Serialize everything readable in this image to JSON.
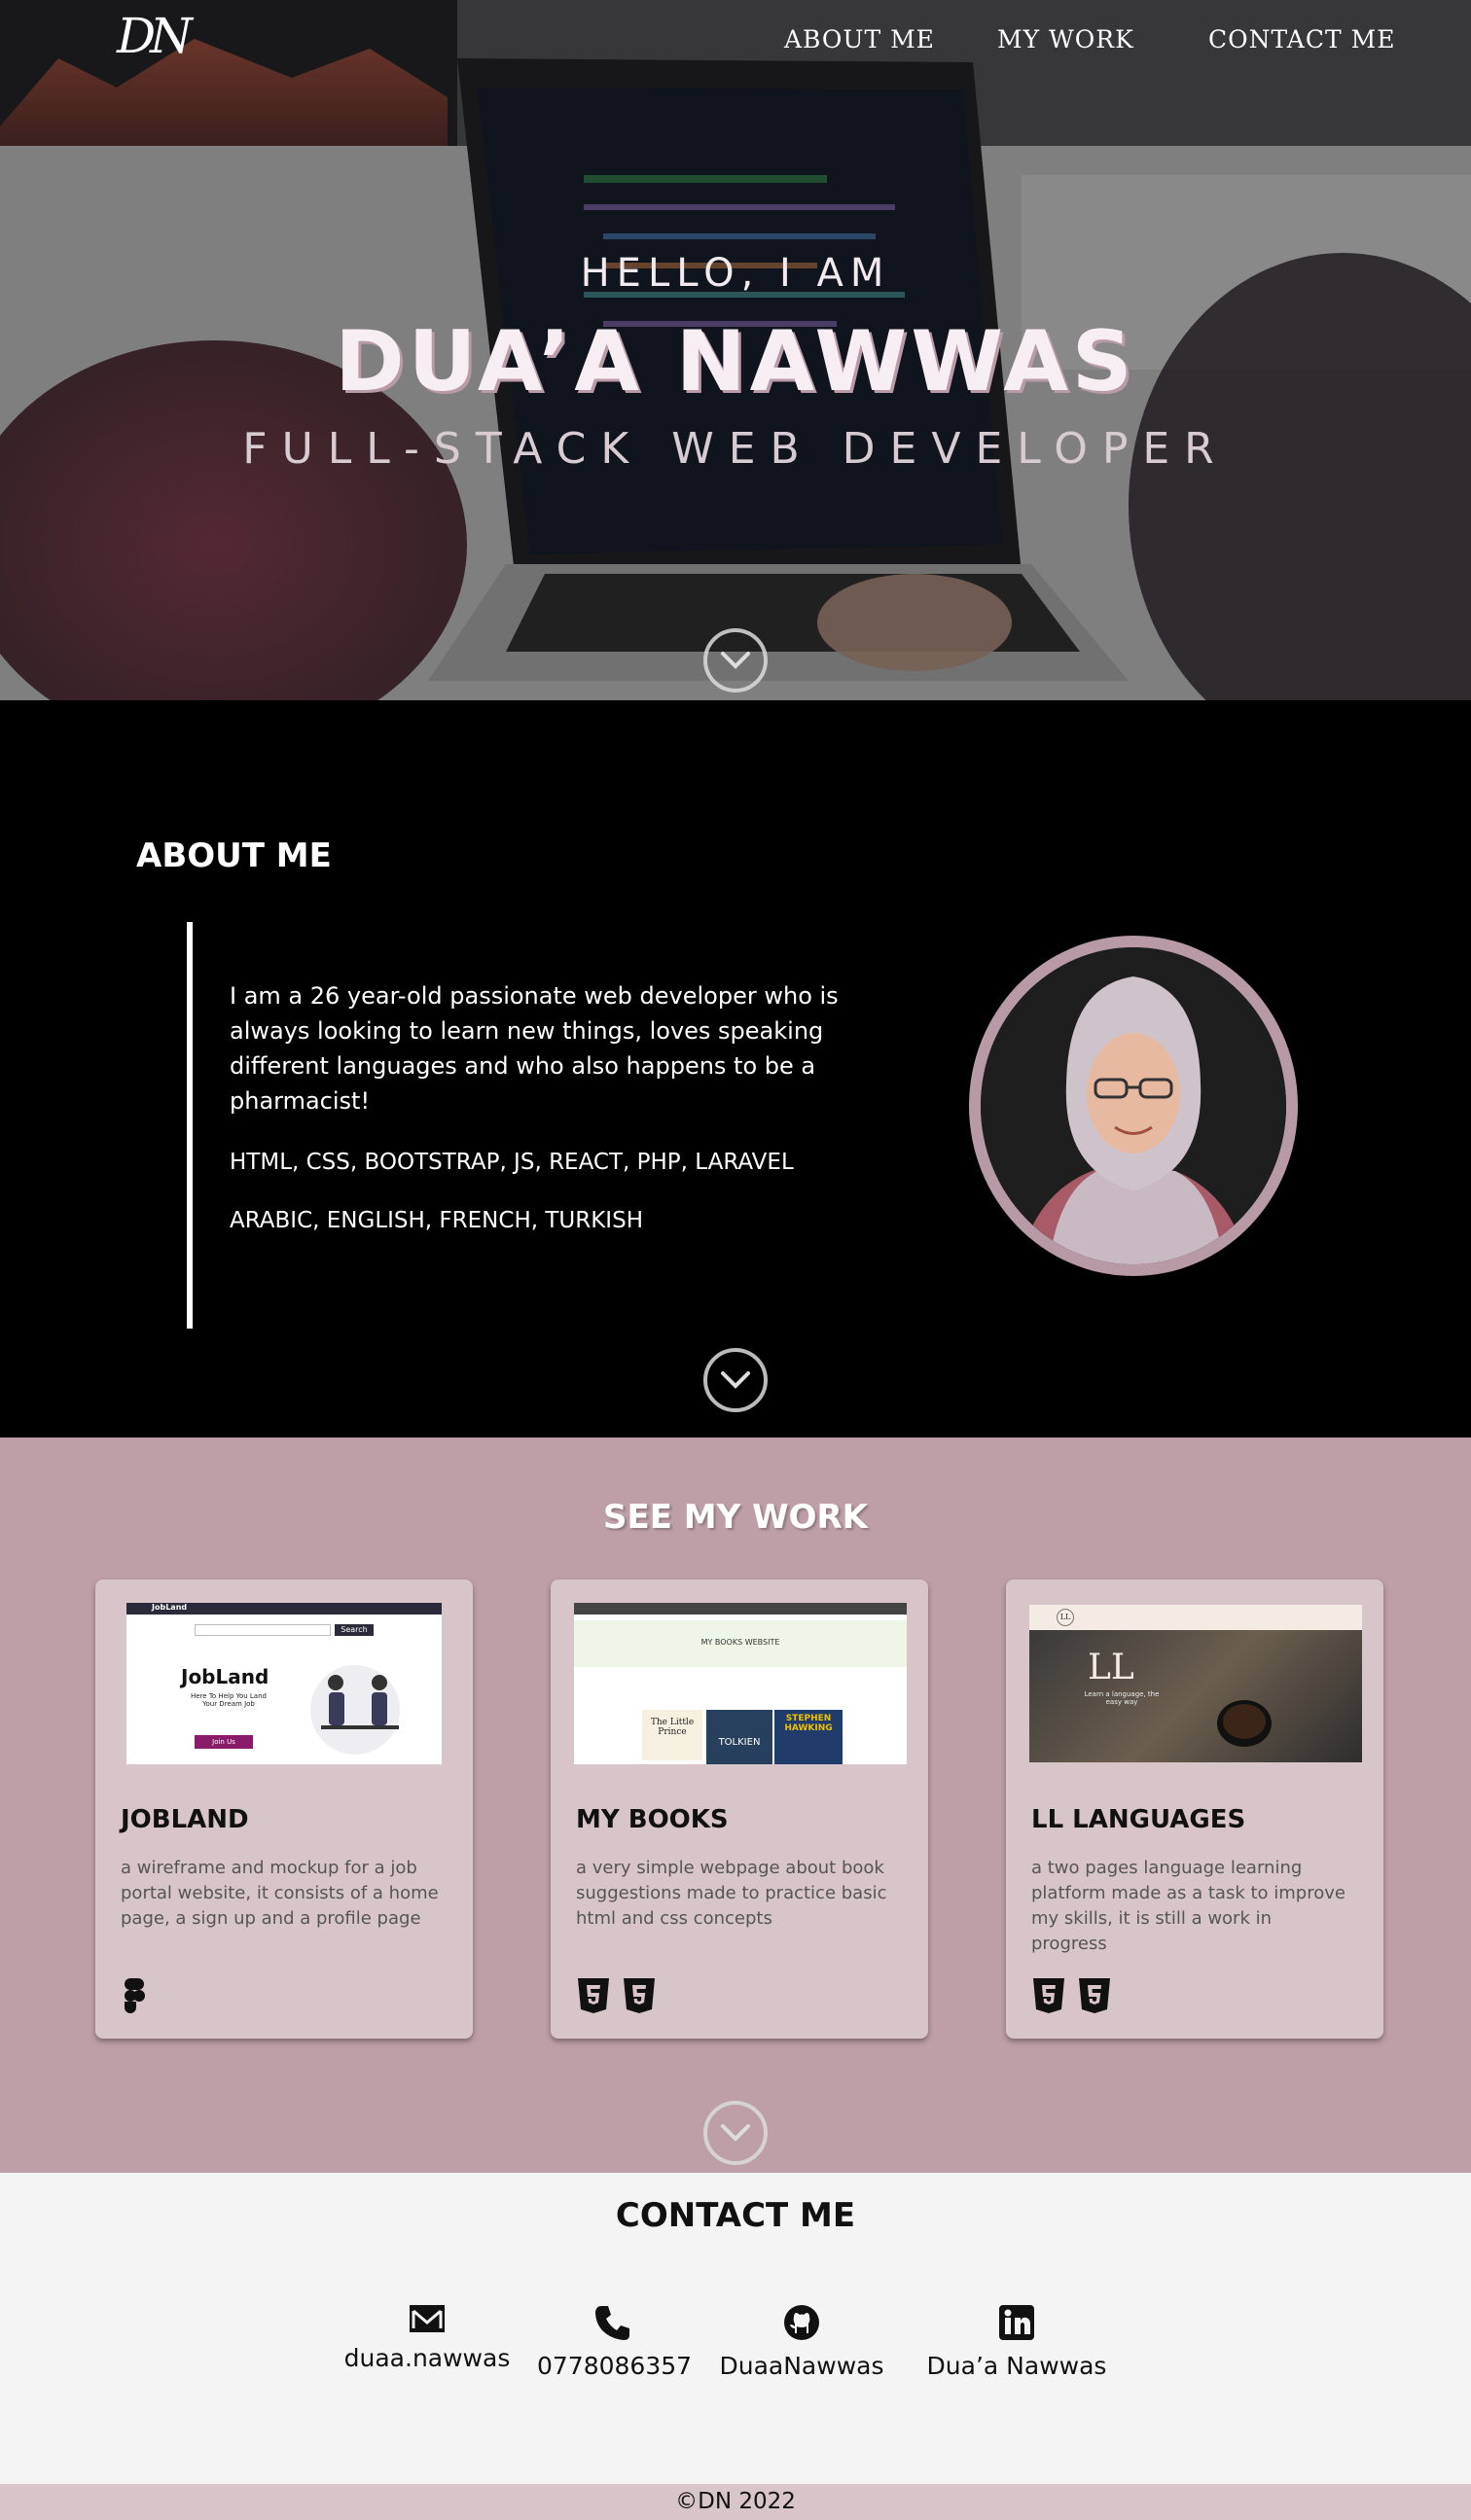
{
  "nav": {
    "logo": "DN",
    "links": [
      "ABOUT ME",
      "MY WORK",
      "CONTACT ME"
    ]
  },
  "hero": {
    "greeting": "HELLO, I AM",
    "name": "DUA’A NAWWAS",
    "role": "FULL-STACK WEB DEVELOPER",
    "scroll_icon": "chevron-down-icon"
  },
  "about": {
    "title": "ABOUT ME",
    "bio": "I am a 26 year-old passionate web developer who is always looking to learn new things, loves speaking different languages and who also happens to be a pharmacist!",
    "skills": "HTML, CSS, BOOTSTRAP, JS, REACT, PHP, LARAVEL",
    "languages": "ARABIC, ENGLISH, FRENCH, TURKISH"
  },
  "work": {
    "title": "SEE MY WORK",
    "projects": [
      {
        "title": "JOBLAND",
        "description": "a wireframe and mockup for a job portal website, it consists of a home page, a sign up and a profile page",
        "icons": [
          "figma-icon"
        ],
        "shot": {
          "brand": "JobLand",
          "headline": "JobLand",
          "sub": "Here To Help You Land Your Dream Job",
          "cta": "Join Us",
          "search": "Search"
        }
      },
      {
        "title": "MY BOOKS",
        "description": "a very simple webpage about book suggestions made to practice basic html and css concepts",
        "icons": [
          "html5-icon",
          "css3-icon"
        ],
        "shot": {
          "headline": "MY BOOKS WEBSITE",
          "book1": "The Little Prince",
          "book2": "TOLKIEN",
          "book3": "STEPHEN HAWKING"
        }
      },
      {
        "title": "LL LANGUAGES",
        "description": "a two pages language learning platform made as a task to improve my skills, it is still a work in progress",
        "icons": [
          "html5-icon",
          "css3-icon"
        ],
        "shot": {
          "logo": "LL",
          "headline": "LL",
          "sub": "Learn a language, the easy way"
        }
      }
    ]
  },
  "contact": {
    "title": "CONTACT ME",
    "items": [
      {
        "icon": "mail-icon",
        "label": "duaa.nawwas"
      },
      {
        "icon": "phone-icon",
        "label": "0778086357"
      },
      {
        "icon": "github-icon",
        "label": "DuaaNawwas"
      },
      {
        "icon": "linkedin-icon",
        "label": "Dua’a Nawwas"
      }
    ]
  },
  "footer": {
    "text": "©DN 2022"
  },
  "colors": {
    "mauve": "#be9fa7",
    "card": "#d8c5ca",
    "ring": "#b89aa6",
    "contact_bg": "#f4f4f4"
  }
}
